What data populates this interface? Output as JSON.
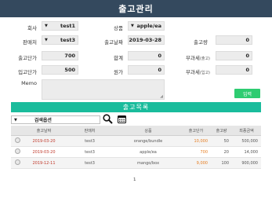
{
  "title": "출고관리",
  "form": {
    "client_label": "회사",
    "client_value": "test1",
    "product_label": "상품",
    "product_value": "apple/ea",
    "seller_label": "판매처",
    "seller_value": "test3",
    "date_label": "출고날짜",
    "date_value": "2019-03-28",
    "qty_label": "출고량",
    "qty_value": "0",
    "out_price_label": "출고단가",
    "out_price_value": "700",
    "total_label": "합계",
    "total_value": "0",
    "vat_label": "부과세",
    "vat_note": "(출고)",
    "vat_value": "0",
    "in_price_label": "입고단가",
    "in_price_value": "500",
    "cost_label": "원가",
    "cost_value": "0",
    "vat2_label": "부과세",
    "vat2_note": "(입고)",
    "vat2_value": "0",
    "memo_label": "Memo",
    "memo_value": "",
    "add_button": "입력"
  },
  "list": {
    "section_title": "출고목록",
    "search_option": "검색옵션",
    "icons": {
      "search": "search-icon",
      "calendar": "calendar-icon"
    },
    "columns": [
      "",
      "출고날짜",
      "판매처",
      "상품",
      "출고단가",
      "출고량",
      "최종금액"
    ],
    "rows": [
      {
        "date": "2019-03-20",
        "seller": "test3",
        "product": "orange/bundle",
        "price": "10,000",
        "qty": "50",
        "amount": "500,000"
      },
      {
        "date": "2019-03-20",
        "seller": "test3",
        "product": "apple/ea",
        "price": "700",
        "qty": "20",
        "amount": "14,000"
      },
      {
        "date": "2019-12-11",
        "seller": "test3",
        "product": "mango/box",
        "price": "9,000",
        "qty": "100",
        "amount": "900,000"
      }
    ],
    "page": "1"
  },
  "colors": {
    "header": "#34495e",
    "band": "#1abc9c",
    "button": "#2ecc71"
  }
}
